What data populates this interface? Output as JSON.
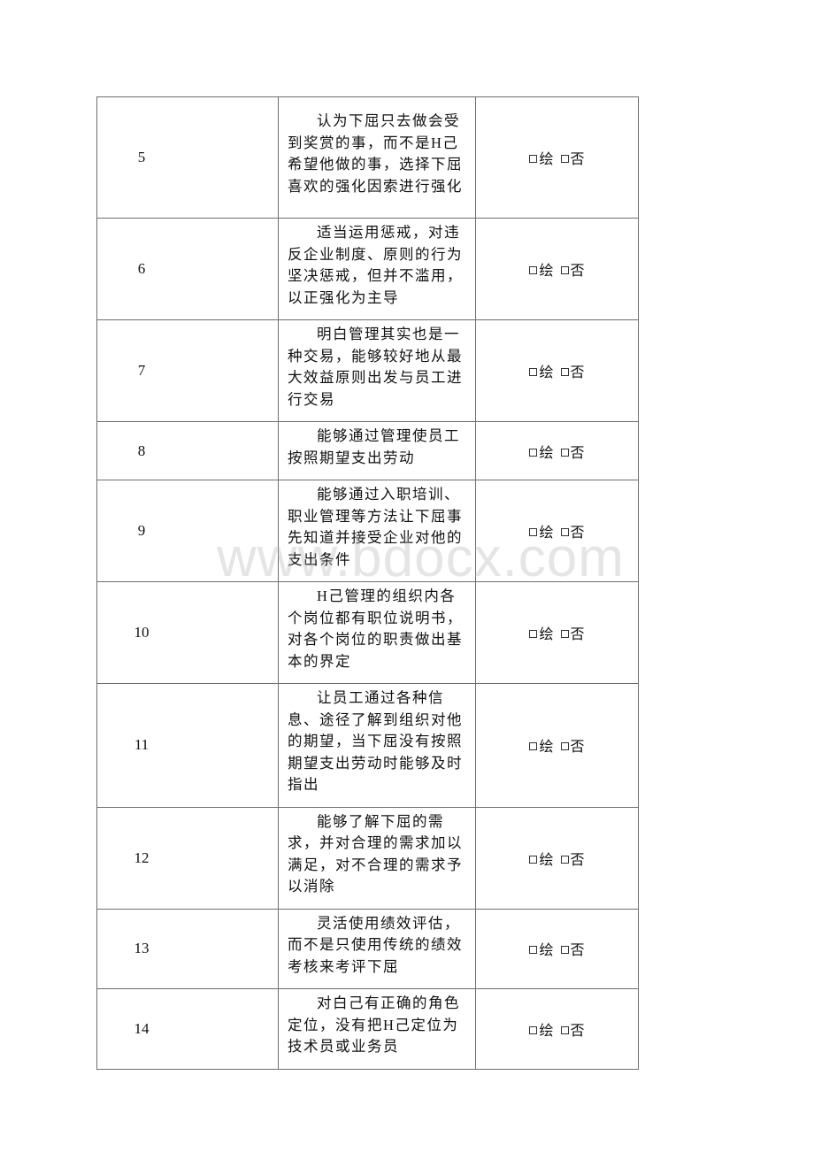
{
  "table": {
    "rows": [
      {
        "num": "5",
        "text": "认为下屈只去做会受到奖赏的事，而不是H己希望他做的事，选择下屈喜欢的强化因索进行强化",
        "options": [
          "绘",
          "否"
        ]
      },
      {
        "num": "6",
        "text": "适当运用惩戒，对违反企业制度、原则的行为坚决惩戒，但并不滥用，以正强化为主导",
        "options": [
          "绘",
          "否"
        ]
      },
      {
        "num": "7",
        "text": "明白管理其实也是一种交易，能够较好地从最大效益原则出发与员工进行交易",
        "options": [
          "绘",
          "否"
        ]
      },
      {
        "num": "8",
        "text": "能够通过管理使员工按照期望支出劳动",
        "options": [
          "绘",
          "否"
        ]
      },
      {
        "num": "9",
        "text": "能够通过入职培训、职业管理等方法让下屈事先知道并接受企业对他的支出条件",
        "options": [
          "绘",
          "否"
        ]
      },
      {
        "num": "10",
        "text": "H己管理的组织内各个岗位都有职位说明书，对各个岗位的职责做出基本的界定",
        "options": [
          "绘",
          "否"
        ]
      },
      {
        "num": "11",
        "text": "让员工通过各种信息、途径了解到组织对他的期望，当下屈没有按照期望支出劳动时能够及时指出",
        "options": [
          "绘",
          "否"
        ]
      },
      {
        "num": "12",
        "text": "能够了解下屈的需求，并对合理的需求加以满足，对不合理的需求予以消除",
        "options": [
          "绘",
          "否"
        ]
      },
      {
        "num": "13",
        "text": "灵活使用绩效评估，而不是只使用传统的绩效考核来考评下屈",
        "options": [
          "绘",
          "否"
        ]
      },
      {
        "num": "14",
        "text": "对白己有正确的角色定位，没有把H己定位为技术员或业务员",
        "options": [
          "绘",
          "否"
        ]
      }
    ]
  },
  "watermark": "www.bdocx.com"
}
